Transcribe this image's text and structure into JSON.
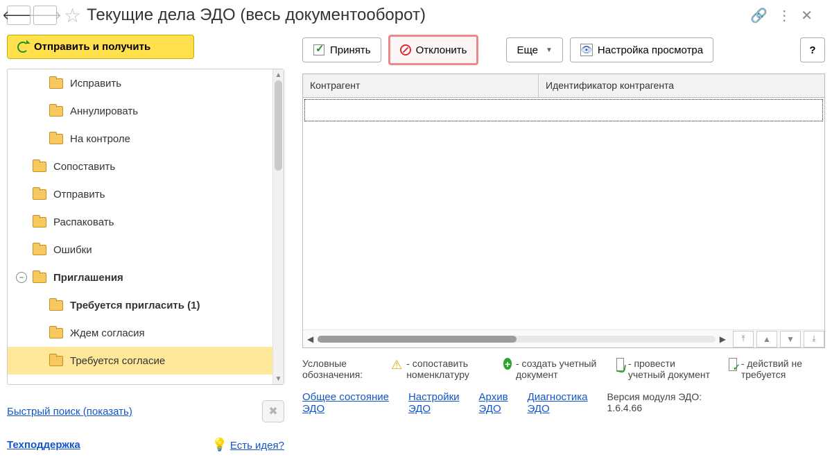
{
  "title": "Текущие дела ЭДО (весь документооборот)",
  "toolbar": {
    "send_receive": "Отправить и получить",
    "accept": "Принять",
    "reject": "Отклонить",
    "more": "Еще",
    "view_settings": "Настройка просмотра",
    "help": "?"
  },
  "tree": {
    "items": [
      {
        "label": "Исправить",
        "indent": 1,
        "bold": false
      },
      {
        "label": "Аннулировать",
        "indent": 1,
        "bold": false
      },
      {
        "label": "На контроле",
        "indent": 1,
        "bold": false
      },
      {
        "label": "Сопоставить",
        "indent": 0,
        "bold": false
      },
      {
        "label": "Отправить",
        "indent": 0,
        "bold": false
      },
      {
        "label": "Распаковать",
        "indent": 0,
        "bold": false
      },
      {
        "label": "Ошибки",
        "indent": 0,
        "bold": false
      },
      {
        "label": "Приглашения",
        "indent": 0,
        "bold": true,
        "toggle": true
      },
      {
        "label": "Требуется пригласить (1)",
        "indent": 1,
        "bold": true
      },
      {
        "label": "Ждем согласия",
        "indent": 1,
        "bold": false
      },
      {
        "label": "Требуется согласие",
        "indent": 1,
        "bold": false,
        "selected": true
      }
    ]
  },
  "quick": {
    "search": "Быстрый поиск (показать)",
    "support": "Техподдержка",
    "idea": "Есть идея?"
  },
  "grid": {
    "col1": "Контрагент",
    "col2": "Идентификатор контрагента"
  },
  "legend": {
    "title": "Условные обозначения:",
    "i1": "- сопоставить номенклатуру",
    "i2": "- создать учетный документ",
    "i3": "- провести учетный документ",
    "i4": "- действий не требуется"
  },
  "footer": {
    "l1a": "Общее состояние",
    "l1b": "ЭДО",
    "l2a": "Настройки",
    "l2b": "ЭДО",
    "l3a": "Архив",
    "l3b": "ЭДО",
    "l4a": "Диагностика",
    "l4b": "ЭДО",
    "ver_label": "Версия модуля ЭДО:",
    "ver": "1.6.4.66"
  }
}
